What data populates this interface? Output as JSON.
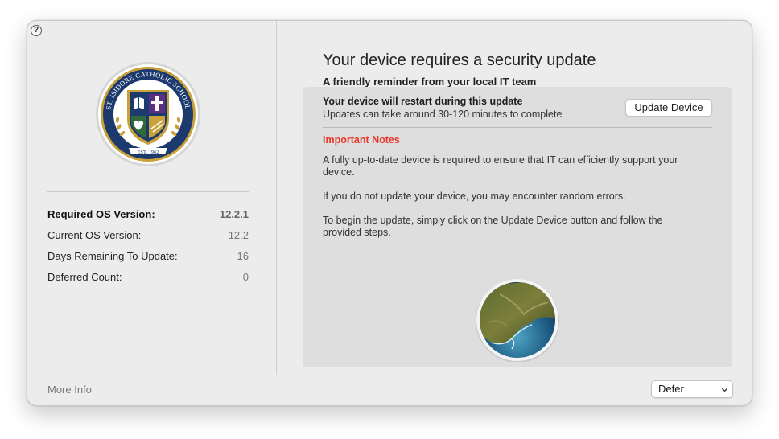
{
  "window": {
    "help_icon": "question-circle-icon",
    "help_glyph": "?"
  },
  "logo": {
    "school_name": "ST. ISIDORE CATHOLIC SCHOOL",
    "established": "EST. 1962",
    "colors": {
      "navy": "#1d3a6e",
      "gold": "#c9a13a",
      "purple": "#5b2d83",
      "green": "#2f6b3a"
    }
  },
  "info": {
    "rows": [
      {
        "label": "Required OS Version:",
        "value": "12.2.1"
      },
      {
        "label": "Current OS Version:",
        "value": "12.2"
      },
      {
        "label": "Days Remaining To Update:",
        "value": "16"
      },
      {
        "label": "Deferred Count:",
        "value": "0"
      }
    ]
  },
  "footer": {
    "more_info": "More Info",
    "defer_selected": "Defer"
  },
  "main": {
    "title": "Your device requires a security update",
    "subtitle": "A friendly reminder from your local IT team",
    "restart_title": "Your device will restart during this update",
    "restart_sub": "Updates can take around 30-120 minutes to complete",
    "update_button": "Update Device",
    "notes_heading": "Important Notes",
    "notes": [
      "A fully up-to-date device is required to ensure that IT can efficiently support your device.",
      "If you do not update your device, you may encounter random errors.",
      "To begin the update, simply click on the Update Device button and follow the provided steps."
    ],
    "os_icon": "macos-monterey-icon"
  },
  "colors": {
    "accent_red": "#e8392e",
    "window_bg": "#ececec",
    "content_box_bg": "#dedede"
  }
}
